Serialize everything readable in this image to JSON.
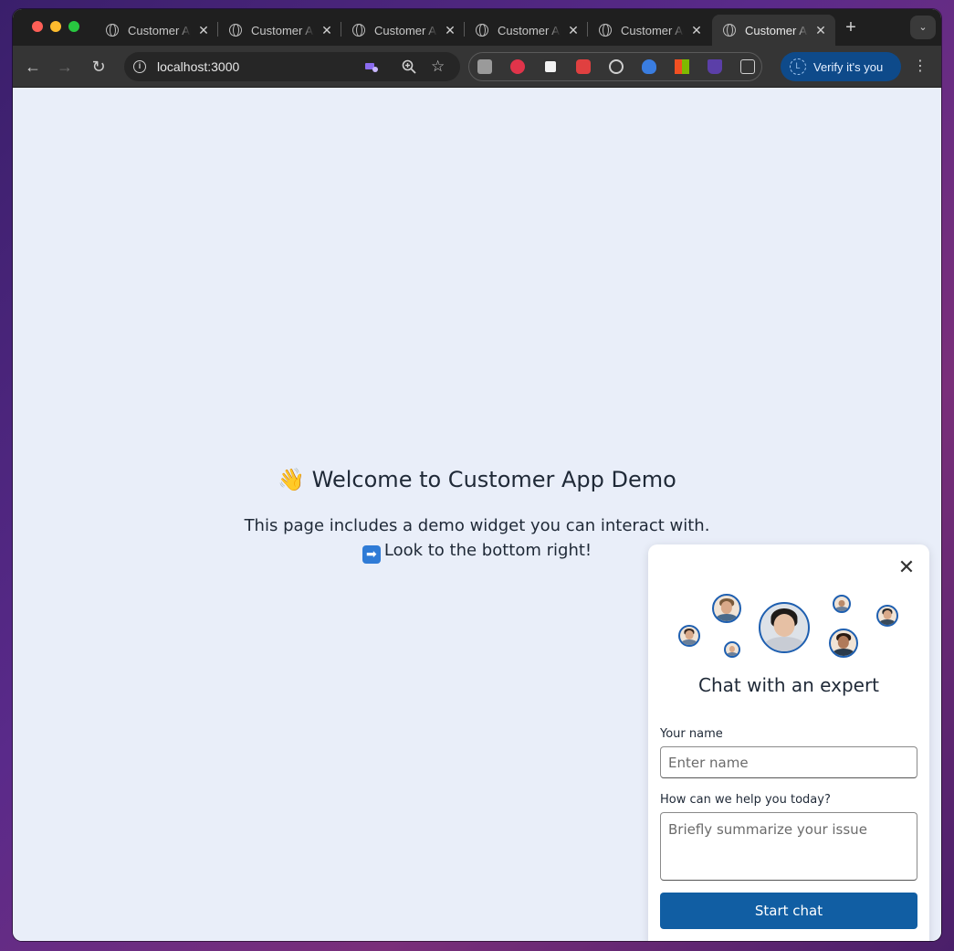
{
  "browser": {
    "tabs": [
      {
        "title": "Customer App Demo",
        "active": false
      },
      {
        "title": "Customer App Demo",
        "active": false
      },
      {
        "title": "Customer App Demo",
        "active": false
      },
      {
        "title": "Customer App Demo",
        "active": false
      },
      {
        "title": "Customer App Demo",
        "active": false
      },
      {
        "title": "Customer App Demo",
        "active": true
      }
    ],
    "close_glyph": "✕",
    "new_tab_glyph": "+",
    "tab_menu_glyph": "⌄",
    "url": "localhost:3000",
    "back_glyph": "←",
    "forward_glyph": "→",
    "reload_glyph": "↻",
    "info_glyph": "i",
    "zoom_glyph": "⚲",
    "star_glyph": "☆",
    "verify_label": "Verify it's you",
    "profile_initial": "L",
    "menu_glyph": "⋮",
    "extensions": [
      "camera-extension-icon",
      "red-extension-icon",
      "notion-extension-icon",
      "pinwheel-extension-icon",
      "target-extension-icon",
      "shield-extension-icon",
      "microsoft-extension-icon",
      "flask-extension-icon",
      "puzzle-extension-icon"
    ]
  },
  "page": {
    "heading_emoji": "👋",
    "heading": "Welcome to Customer App Demo",
    "description": "This page includes a demo widget you can interact with.",
    "hint_arrow": "➡",
    "hint": "Look to the bottom right!"
  },
  "widget": {
    "close_glyph": "✕",
    "title": "Chat with an expert",
    "name_label": "Your name",
    "name_placeholder": "Enter name",
    "issue_label": "How can we help you today?",
    "issue_placeholder": "Briefly summarize your issue",
    "submit_label": "Start chat"
  },
  "colors": {
    "accent": "#115ea3",
    "page_background": "#e9eef9",
    "avatar_ring": "#1e5fb0"
  }
}
